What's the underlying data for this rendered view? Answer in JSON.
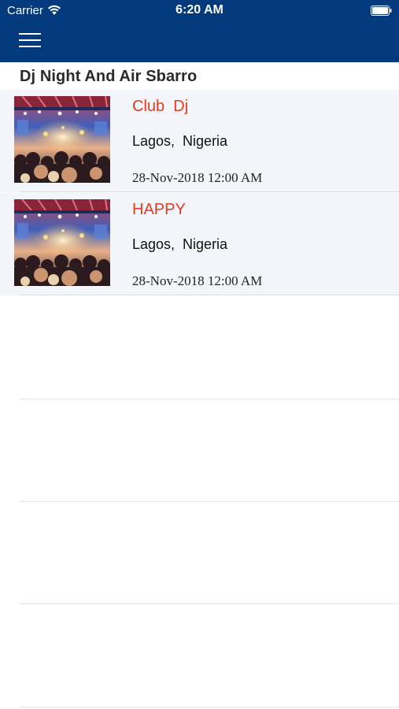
{
  "status_bar": {
    "carrier": "Carrier",
    "time": "6:20 AM",
    "icons": [
      "wifi-icon",
      "battery-icon"
    ]
  },
  "nav": {
    "menu_icon": "hamburger-menu-icon",
    "background_color": "#023a7d"
  },
  "section": {
    "title": "Dj Night And Air Sbarro"
  },
  "events": [
    {
      "name": "Club  Dj",
      "location": "Lagos,  Nigeria",
      "date": "28-Nov-2018 12:00 AM",
      "image": "concert-crowd-photo"
    },
    {
      "name": "HAPPY",
      "location": "Lagos,  Nigeria",
      "date": "28-Nov-2018 12:00 AM",
      "image": "concert-crowd-photo"
    }
  ],
  "colors": {
    "accent": "#e53b1f",
    "row_background": "#f2f5f9",
    "header": "#023a7d"
  }
}
